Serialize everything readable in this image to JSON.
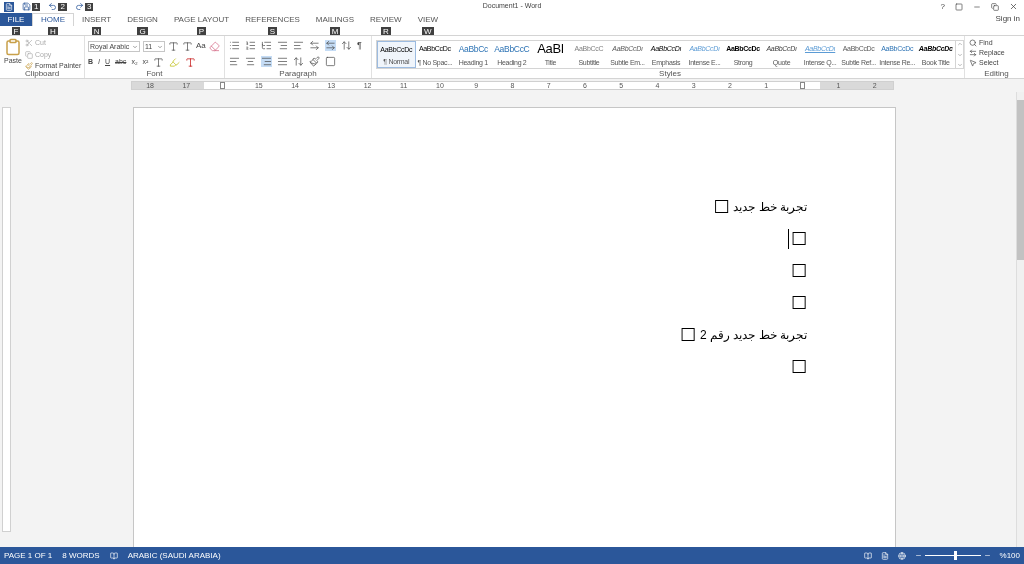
{
  "title_bar": {
    "title": "Document1 - Word",
    "help": "?",
    "sign_in": "Sign in"
  },
  "quick_access": [
    {
      "tip": "1"
    },
    {
      "tip": "2"
    },
    {
      "tip": "3"
    }
  ],
  "tabs": [
    {
      "label": "FILE",
      "tip": "F",
      "selected": false,
      "kind": "file"
    },
    {
      "label": "HOME",
      "tip": "H",
      "selected": true,
      "kind": "tab"
    },
    {
      "label": "INSERT",
      "tip": "N",
      "selected": false,
      "kind": "tab"
    },
    {
      "label": "DESIGN",
      "tip": "G",
      "selected": false,
      "kind": "tab"
    },
    {
      "label": "PAGE LAYOUT",
      "tip": "P",
      "selected": false,
      "kind": "tab"
    },
    {
      "label": "REFERENCES",
      "tip": "S",
      "selected": false,
      "kind": "tab"
    },
    {
      "label": "MAILINGS",
      "tip": "M",
      "selected": false,
      "kind": "tab"
    },
    {
      "label": "REVIEW",
      "tip": "R",
      "selected": false,
      "kind": "tab"
    },
    {
      "label": "VIEW",
      "tip": "W",
      "selected": false,
      "kind": "tab"
    }
  ],
  "clipboard": {
    "paste": "Paste",
    "cut": "Cut",
    "copy": "Copy",
    "format_painter": "Format Painter",
    "label": "Clipboard"
  },
  "font": {
    "name": "Royal Arabic",
    "size": "11",
    "case": "Aa",
    "bold": "B",
    "italic": "I",
    "underline": "U",
    "strike": "abc",
    "subscript": "x₂",
    "superscript": "x²",
    "label": "Font"
  },
  "paragraph": {
    "pilcrow": "¶",
    "label": "Paragraph"
  },
  "styles": {
    "label": "Styles",
    "items": [
      {
        "preview": "AaBbCcDc",
        "name": "¶ Normal",
        "selected": true,
        "kind": "plain"
      },
      {
        "preview": "AaBbCcDc",
        "name": "¶ No Spac...",
        "selected": false,
        "kind": "plain"
      },
      {
        "preview": "AaBbCc",
        "name": "Heading 1",
        "selected": false,
        "kind": "heading"
      },
      {
        "preview": "AaBbCcC",
        "name": "Heading 2",
        "selected": false,
        "kind": "heading"
      },
      {
        "preview": "AaBl",
        "name": "Title",
        "selected": false,
        "kind": "title"
      },
      {
        "preview": "AaBbCcC",
        "name": "Subtitle",
        "selected": false,
        "kind": "subtitle"
      },
      {
        "preview": "AaBbCcDı",
        "name": "Subtle Em...",
        "selected": false,
        "kind": "subtleemphasis"
      },
      {
        "preview": "AaBbCcDı",
        "name": "Emphasis",
        "selected": false,
        "kind": "emphasis"
      },
      {
        "preview": "AaBbCcDı",
        "name": "Intense E...",
        "selected": false,
        "kind": "intenseemphasis"
      },
      {
        "preview": "AaBbCcDc",
        "name": "Strong",
        "selected": false,
        "kind": "strong"
      },
      {
        "preview": "AaBbCcDı",
        "name": "Quote",
        "selected": false,
        "kind": "quote"
      },
      {
        "preview": "AaBbCcDı",
        "name": "Intense Q...",
        "selected": false,
        "kind": "intensequote"
      },
      {
        "preview": "AaBbCcDc",
        "name": "Subtle Ref...",
        "selected": false,
        "kind": "subtlereference"
      },
      {
        "preview": "AaBbCcDc",
        "name": "Intense Re...",
        "selected": false,
        "kind": "intensereference"
      },
      {
        "preview": "AaBbCcDc",
        "name": "Book Title",
        "selected": false,
        "kind": "booktitle"
      }
    ]
  },
  "editing": {
    "find": "Find",
    "replace": "Replace",
    "select": "Select",
    "label": "Editing"
  },
  "ruler": [
    {
      "kind": "number",
      "label": "18"
    },
    {
      "kind": "number",
      "label": "17"
    },
    {
      "kind": "marker"
    },
    {
      "kind": "number",
      "label": "15"
    },
    {
      "kind": "number",
      "label": "14"
    },
    {
      "kind": "number",
      "label": "13"
    },
    {
      "kind": "number",
      "label": "12"
    },
    {
      "kind": "number",
      "label": "11"
    },
    {
      "kind": "number",
      "label": "10"
    },
    {
      "kind": "number",
      "label": "9"
    },
    {
      "kind": "number",
      "label": "8"
    },
    {
      "kind": "number",
      "label": "7"
    },
    {
      "kind": "number",
      "label": "6"
    },
    {
      "kind": "number",
      "label": "5"
    },
    {
      "kind": "number",
      "label": "4"
    },
    {
      "kind": "number",
      "label": "3"
    },
    {
      "kind": "number",
      "label": "2"
    },
    {
      "kind": "number",
      "label": "1"
    },
    {
      "kind": "marker"
    },
    {
      "kind": "number",
      "label": "1"
    },
    {
      "kind": "number",
      "label": "2"
    }
  ],
  "document": {
    "lines": [
      {
        "text": "تجربة خط جديد",
        "mark": "☐",
        "cursor": false
      },
      {
        "mark": "☐",
        "cursor": true
      },
      {
        "mark": "☐",
        "cursor": false
      },
      {
        "mark": "☐",
        "cursor": false
      },
      {
        "text": "تجربة خط جديد رقم 2",
        "mark": "☐",
        "cursor": false
      },
      {
        "mark": "☐",
        "cursor": false
      }
    ]
  },
  "status_bar": {
    "page": "PAGE 1 OF 1",
    "words": "8 WORDS",
    "language": "ARABIC (SAUDI ARABIA)",
    "zoom": "%100",
    "zoom_slider": {
      "level": 0.53
    }
  }
}
